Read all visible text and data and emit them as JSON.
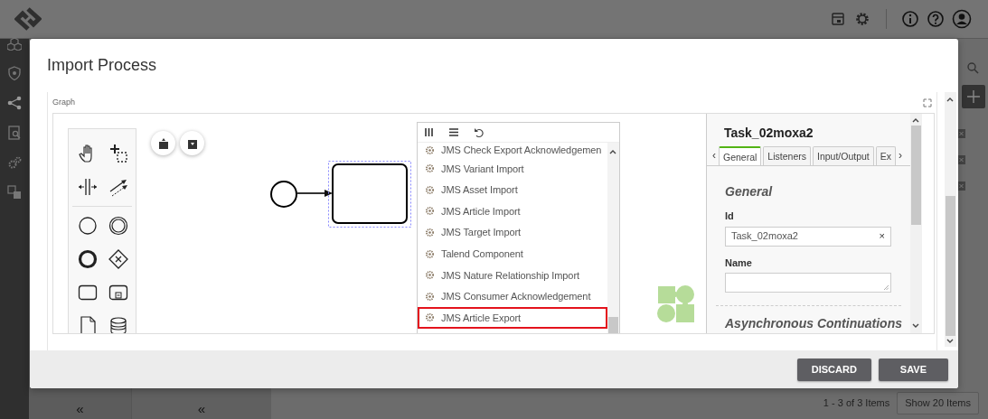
{
  "app": {
    "pager_text": "1 - 3 of 3 Items",
    "page_size_button": "Show 20 Items",
    "collapse_toggles": [
      "«",
      "«"
    ]
  },
  "dialog": {
    "title": "Import Process",
    "graph": {
      "label": "Graph",
      "component_list": {
        "items": [
          {
            "label": "JMS Check Export Acknowledgemen",
            "selected": false
          },
          {
            "label": "JMS Variant Import",
            "selected": false
          },
          {
            "label": "JMS Asset Import",
            "selected": false
          },
          {
            "label": "JMS Article Import",
            "selected": false
          },
          {
            "label": "JMS Target Import",
            "selected": false
          },
          {
            "label": "Talend Component",
            "selected": false
          },
          {
            "label": "JMS Nature Relationship Import",
            "selected": false
          },
          {
            "label": "JMS Consumer Acknowledgement",
            "selected": false
          },
          {
            "label": "JMS Article Export",
            "selected": true
          }
        ]
      },
      "properties": {
        "title": "Task_02moxa2",
        "tab_prev": "‹",
        "tab_next": "›",
        "tabs": [
          {
            "label": "General",
            "selected": true
          },
          {
            "label": "Listeners",
            "selected": false
          },
          {
            "label": "Input/Output",
            "selected": false
          },
          {
            "label": "Ex",
            "selected": false
          }
        ],
        "section": "General",
        "fields": [
          {
            "kind": "input",
            "label": "Id",
            "value": "Task_02moxa2",
            "clear": "×"
          },
          {
            "kind": "textarea",
            "label": "Name"
          }
        ],
        "next_section": "Asynchronous Continuations"
      }
    },
    "buttons": [
      "DISCARD",
      "SAVE"
    ]
  }
}
